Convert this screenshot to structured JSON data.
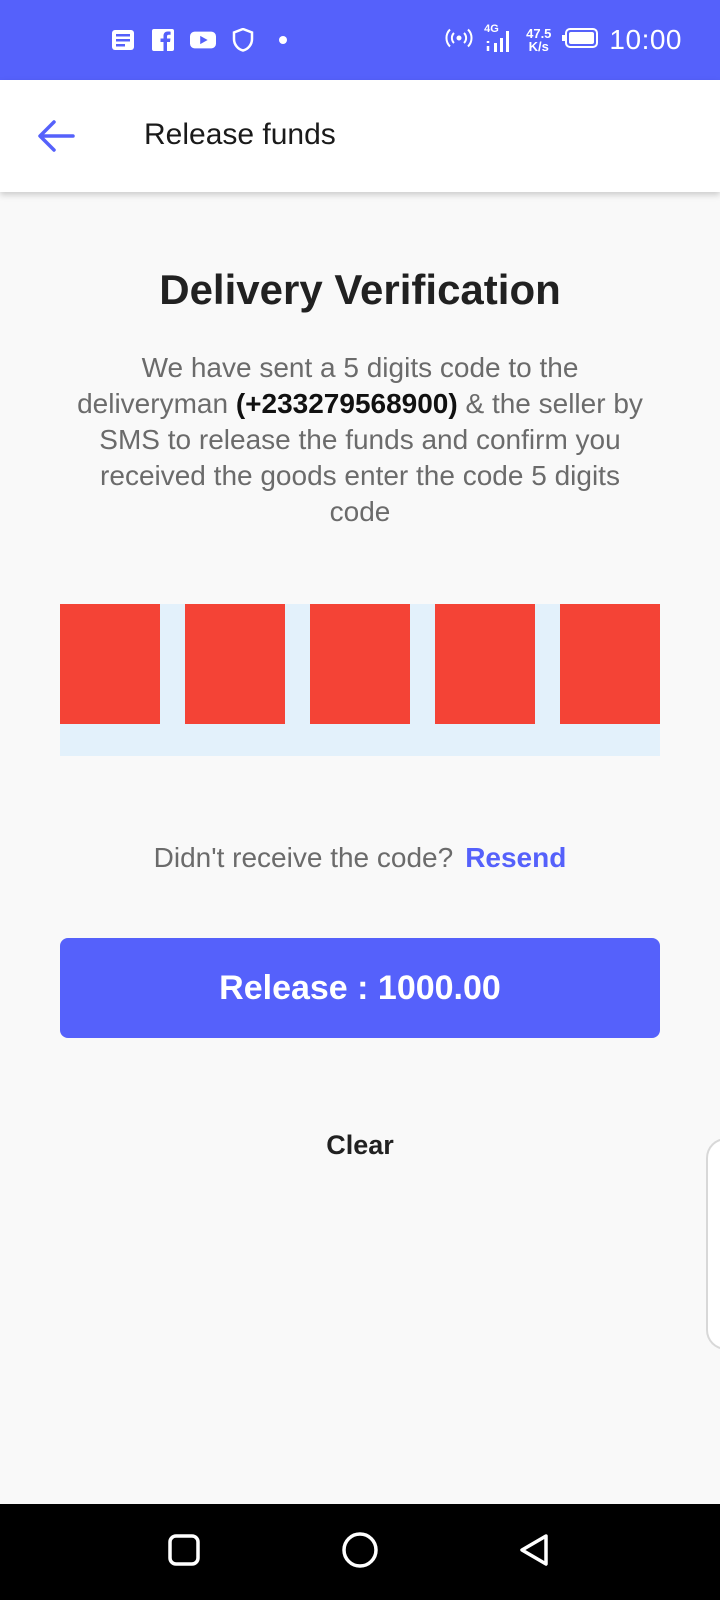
{
  "status_bar": {
    "left_icons": [
      "news-icon",
      "facebook-icon",
      "youtube-icon",
      "shield-icon",
      "dot-icon"
    ],
    "hotspot_icon": "hotspot-icon",
    "network_type": "4G",
    "speed_value": "47.5",
    "speed_unit": "K/s",
    "time": "10:00"
  },
  "app_bar": {
    "back_icon": "arrow-left-icon",
    "title": "Release funds"
  },
  "main": {
    "heading": "Delivery Verification",
    "description_before": "We have  sent a 5 digits code to the deliveryman ",
    "phone": "(+233279568900)",
    "description_after": " & the seller by SMS  to release the funds and confirm you received the  goods enter the code 5 digits code",
    "otp_digits": [
      "",
      "",
      "",
      "",
      ""
    ],
    "resend_prompt": "Didn't receive the code?",
    "resend_label": "Resend",
    "release_label": "Release : 1000.00",
    "clear_label": "Clear"
  },
  "colors": {
    "primary": "#5561fb",
    "otp_box": "#f44336",
    "otp_background": "#e3f1fb",
    "background": "#f9f9f9"
  },
  "nav_bar": {
    "icons": [
      "recents-square-icon",
      "home-circle-icon",
      "back-triangle-icon"
    ]
  }
}
